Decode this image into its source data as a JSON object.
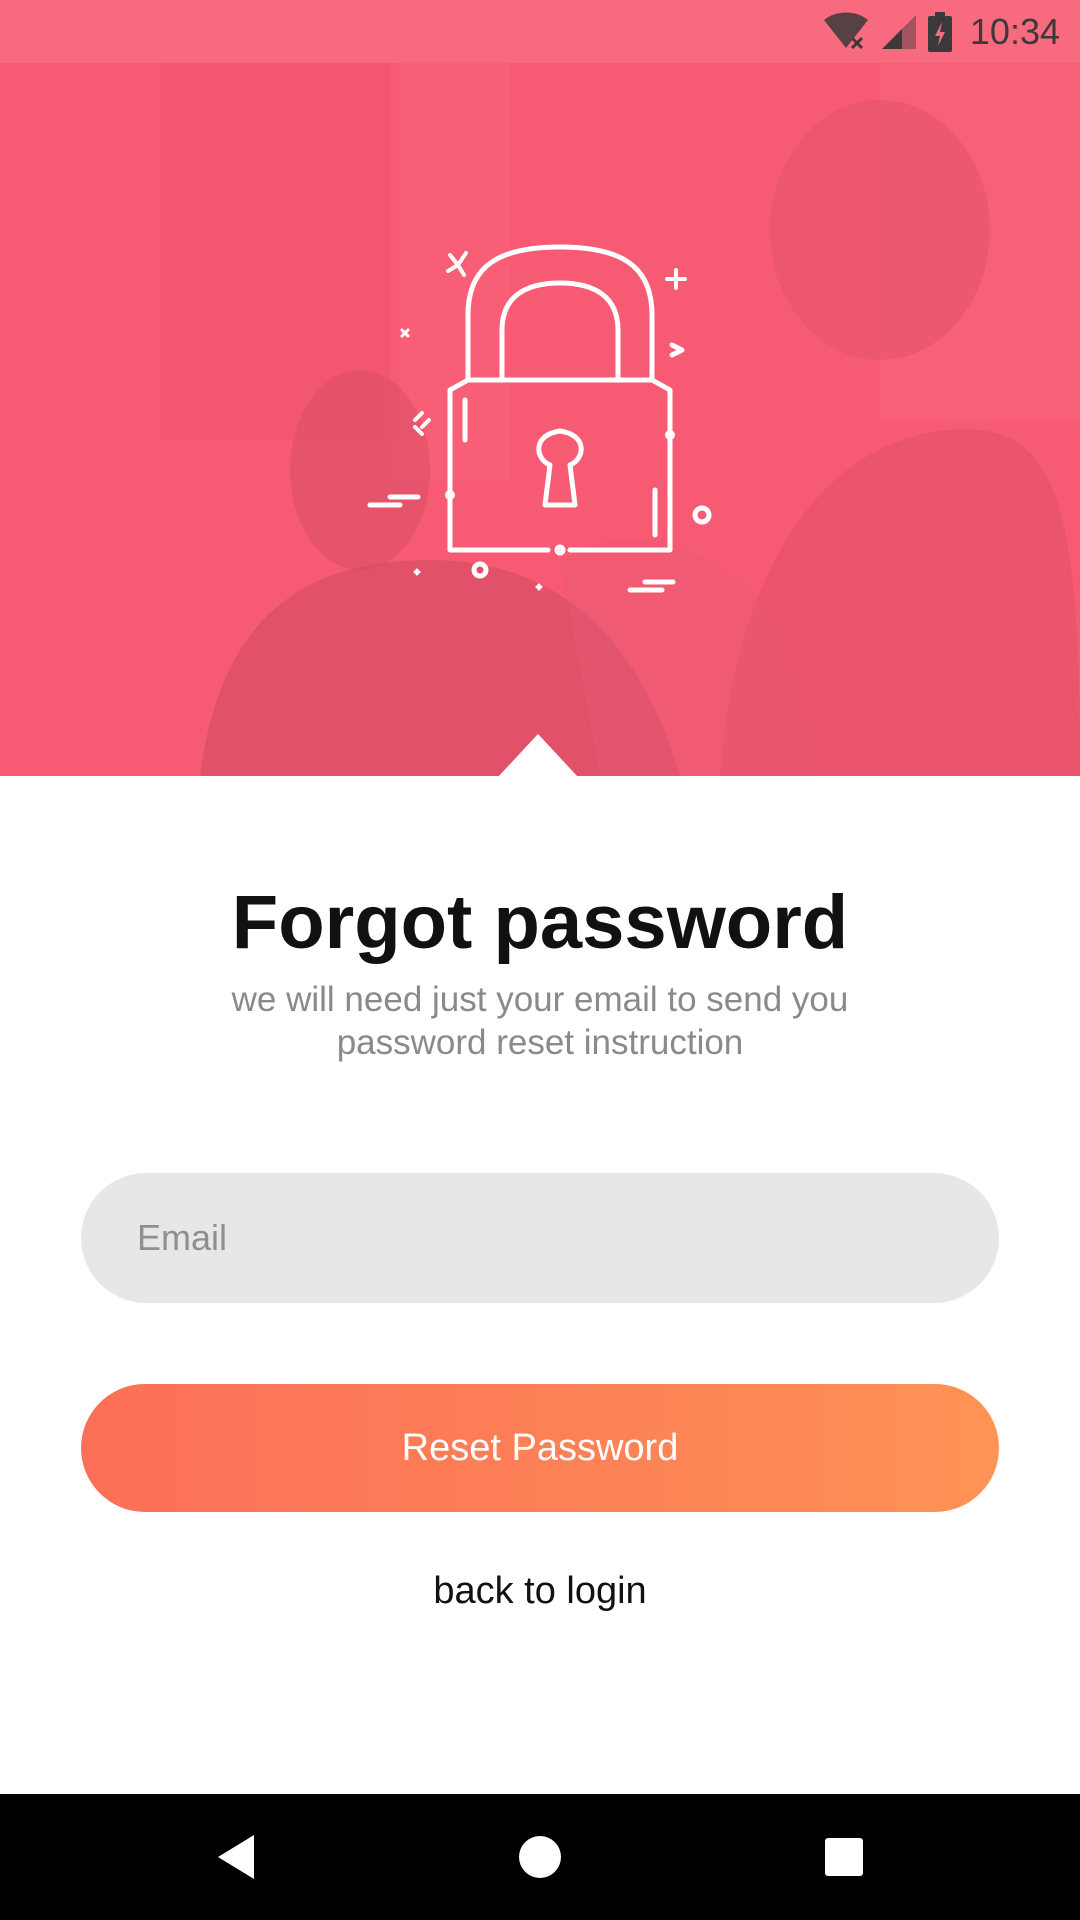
{
  "status_bar": {
    "time": "10:34",
    "background": "#f86a7e",
    "icons": [
      "wifi-off-icon",
      "cell-signal-icon",
      "battery-charging-icon"
    ]
  },
  "hero": {
    "colors": {
      "overlay": "#f5586f"
    },
    "illustration": "padlock-icon"
  },
  "forgot_password": {
    "title": "Forgot password",
    "subtitle": "we will need just your email to send you password reset instruction",
    "email": {
      "placeholder": "Email",
      "value": ""
    },
    "reset_button_label": "Reset Password",
    "back_link_label": "back to login"
  },
  "theme": {
    "button_gradient_start": "#fc6f58",
    "button_gradient_end": "#ff9355",
    "input_background": "#e8e6e8"
  },
  "nav_bar": {
    "buttons": [
      "back-icon",
      "home-icon",
      "recents-icon"
    ]
  }
}
